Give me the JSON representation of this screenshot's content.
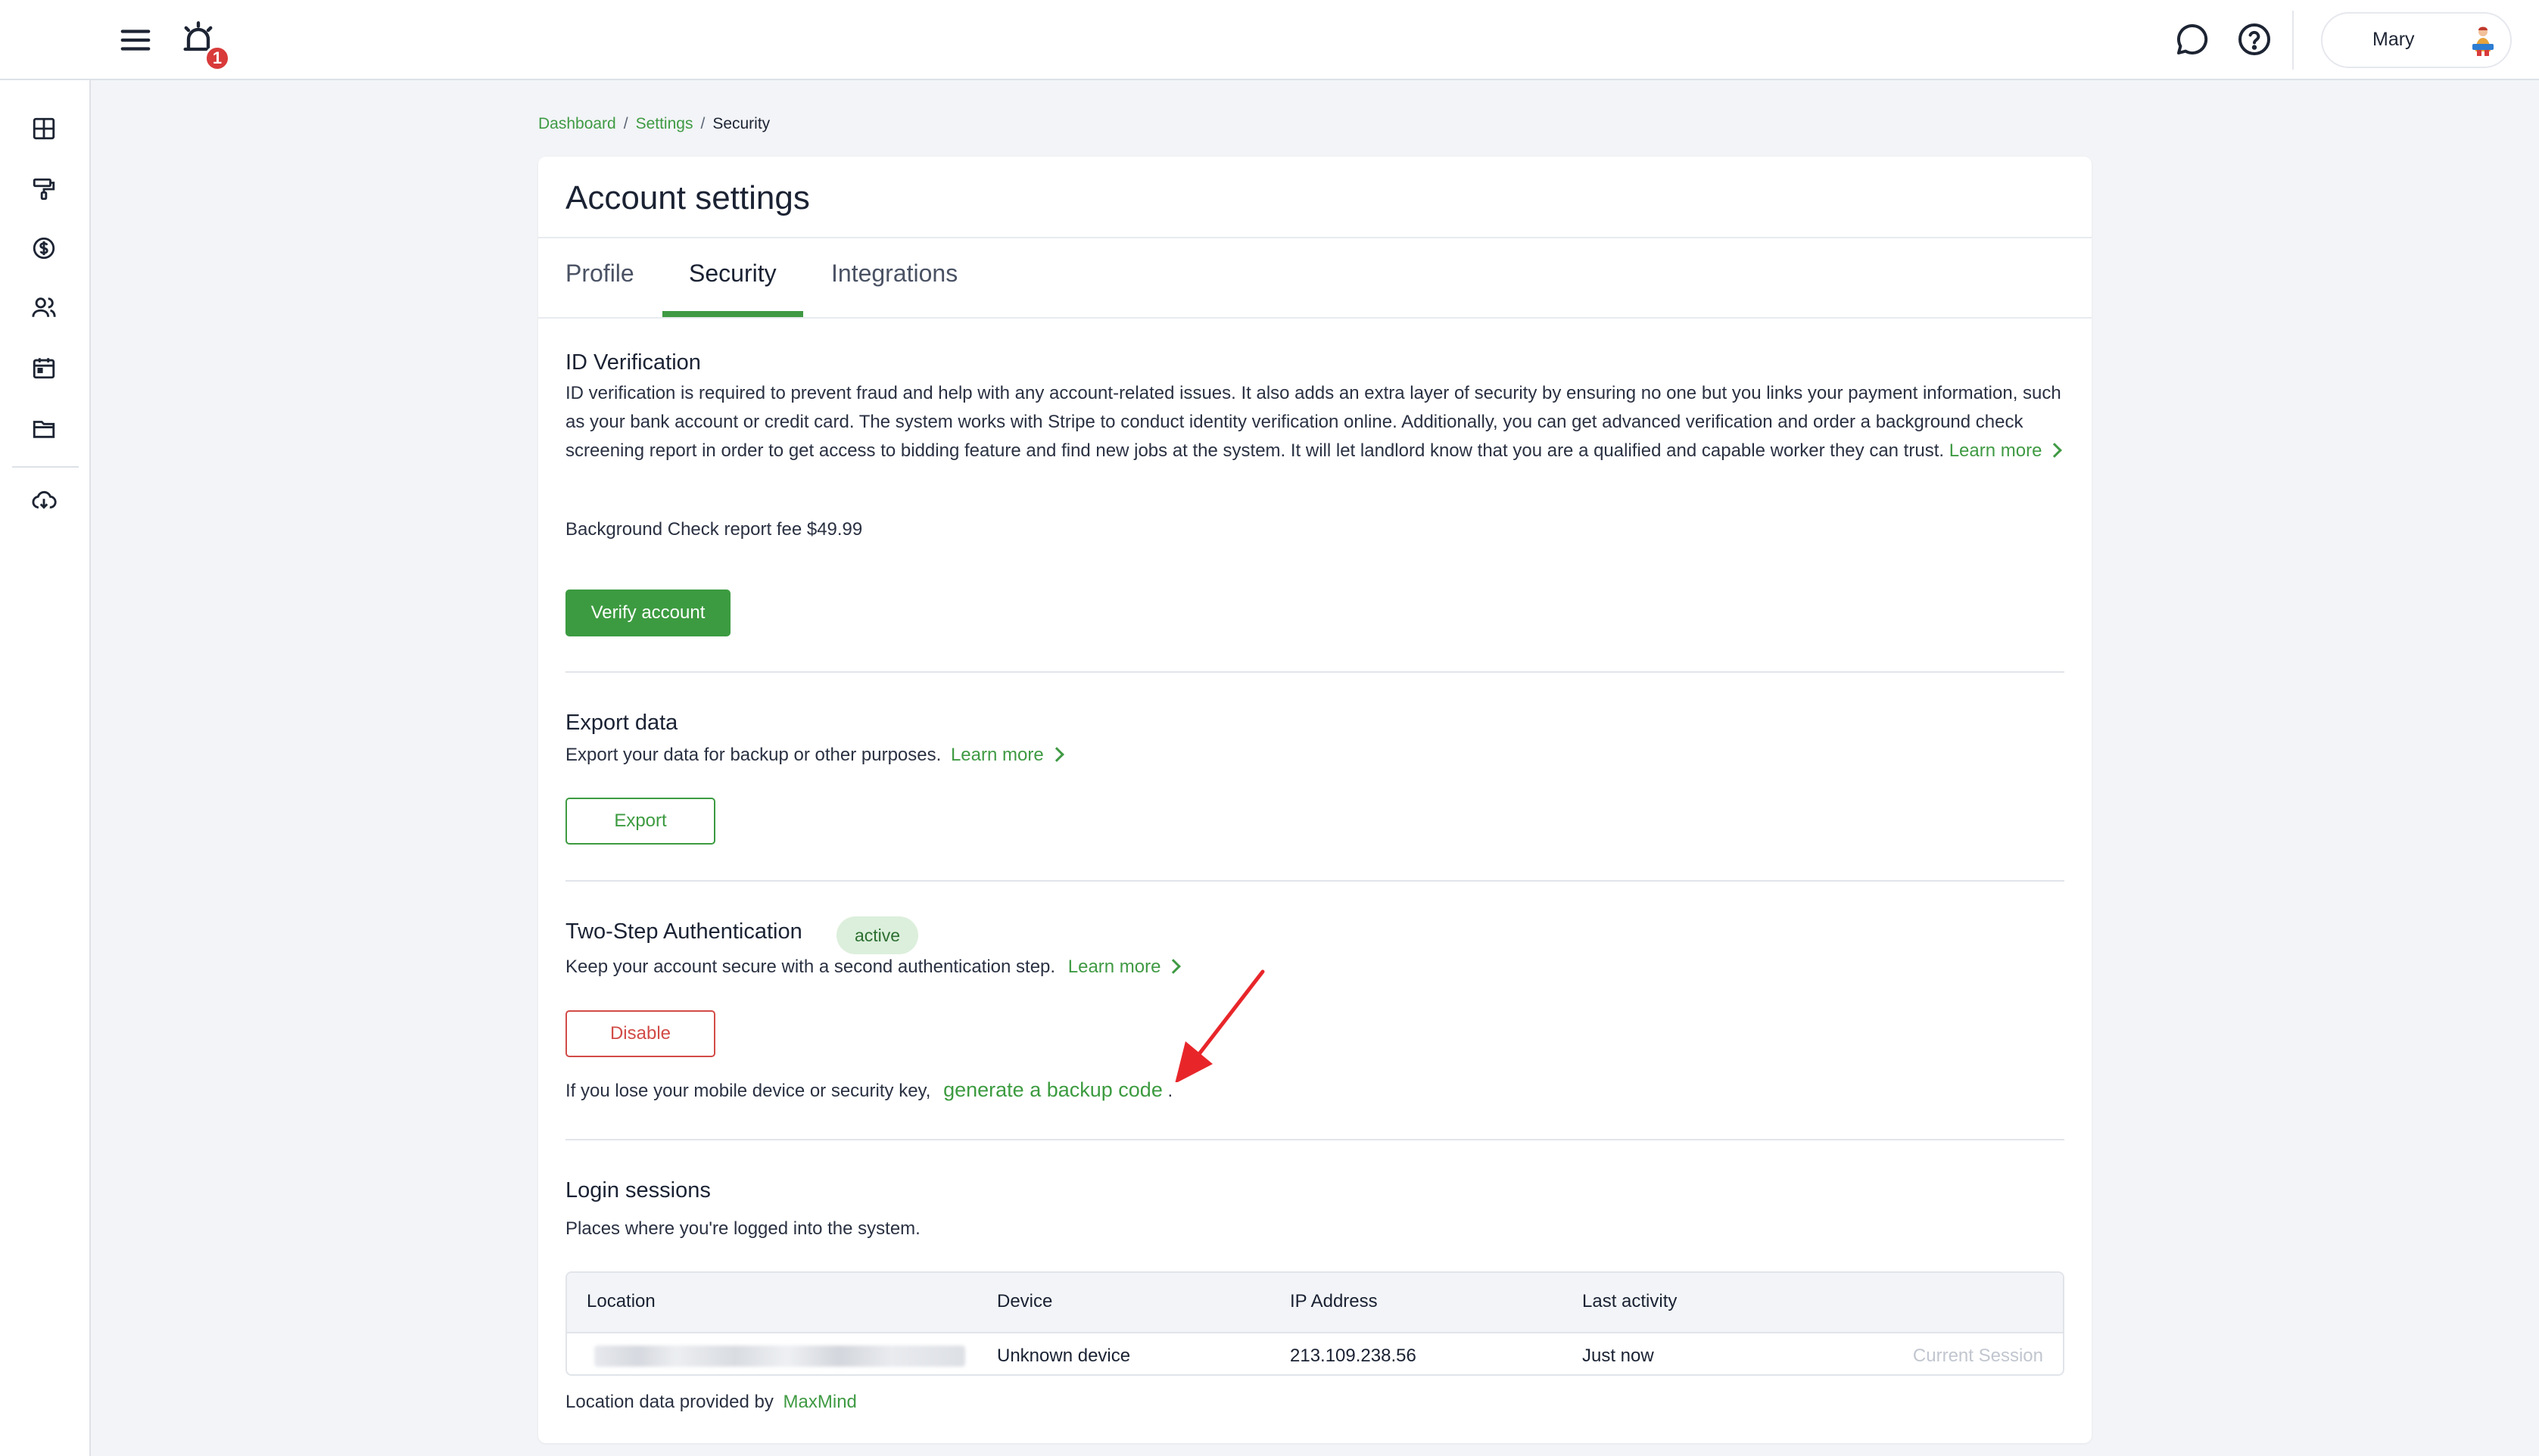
{
  "topbar": {
    "notification_count": "1",
    "user_name": "Mary"
  },
  "sidebar": {
    "items": [
      {
        "icon": "dashboard-icon"
      },
      {
        "icon": "paint-roller-icon"
      },
      {
        "icon": "dollar-icon"
      },
      {
        "icon": "users-icon"
      },
      {
        "icon": "calendar-icon"
      },
      {
        "icon": "folder-icon"
      },
      {
        "icon": "cloud-download-icon"
      }
    ]
  },
  "breadcrumb": {
    "items": [
      "Dashboard",
      "Settings"
    ],
    "separator": "/",
    "current": "Security"
  },
  "page": {
    "title": "Account settings",
    "tabs": [
      {
        "label": "Profile"
      },
      {
        "label": "Security"
      },
      {
        "label": "Integrations"
      }
    ]
  },
  "id_verification": {
    "title": "ID Verification",
    "description": "ID verification is required to prevent fraud and help with any account-related issues. It also adds an extra layer of security by ensuring no one but you links your payment information, such as your bank account or credit card. The system works with Stripe to conduct identity verification online. Additionally, you can get advanced verification and order a background check screening report in order to get access to bidding feature and find new jobs at the system. It will let landlord know that you are a qualified and capable worker they can trust.",
    "learn_more": "Learn more",
    "fee_text": "Background Check report fee $49.99",
    "button": "Verify account"
  },
  "export_data": {
    "title": "Export data",
    "description": "Export your data for backup or other purposes.",
    "learn_more": "Learn more",
    "button": "Export"
  },
  "two_step": {
    "title": "Two-Step Authentication",
    "status": "active",
    "description": "Keep your account secure with a second authentication step.",
    "learn_more": "Learn more",
    "button": "Disable",
    "backup_prefix": "If you lose your mobile device or security key,",
    "backup_link": "generate a backup code",
    "backup_suffix": "."
  },
  "login_sessions": {
    "title": "Login sessions",
    "description": "Places where you're logged into the system.",
    "columns": [
      "Location",
      "Device",
      "IP Address",
      "Last activity"
    ],
    "rows": [
      {
        "location": "",
        "device": "Unknown device",
        "ip": "213.109.238.56",
        "last_activity": "Just now",
        "tag": "Current Session"
      }
    ],
    "footnote_prefix": "Location data provided by",
    "footnote_link": "MaxMind"
  },
  "colors": {
    "accent": "#3c9b40",
    "danger": "#d24b47",
    "badge_bg": "#dcefdc",
    "notification": "#d93a3a",
    "annotation_arrow": "#e8262a"
  }
}
